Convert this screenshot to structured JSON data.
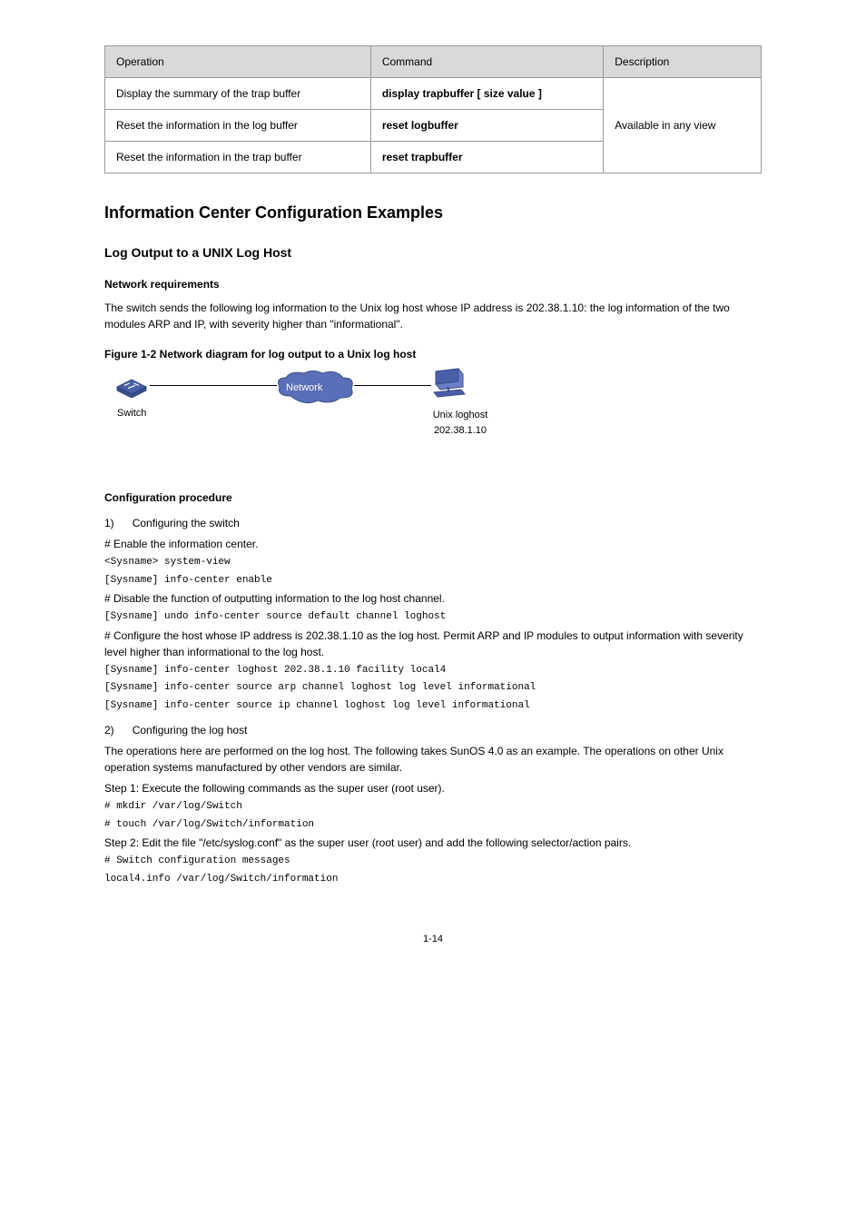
{
  "table": {
    "headers": [
      "Operation",
      "Command",
      "Description"
    ],
    "rows": [
      {
        "op": "Display the summary of the trap buffer",
        "cmd": "display trapbuffer [ size value ]",
        "desc_rowspan": true
      },
      {
        "op": "Reset the information in the log buffer",
        "cmd": "reset logbuffer",
        "desc": ""
      },
      {
        "op": "Reset the information in the trap buffer",
        "cmd": "reset trapbuffer",
        "desc": "Available in any view"
      }
    ]
  },
  "h1": "Information Center Configuration Examples",
  "h2_1": "Log Output to a UNIX Log Host",
  "h3_1": "Network requirements",
  "req_p1": "The switch sends the following log information to the Unix log host whose IP address is 202.38.1.10: the log information of the two modules ARP and IP, with severity higher than \"informational\".",
  "fig_caption": "Figure 1-2 Network diagram for log output to a Unix log host",
  "diagram": {
    "switch_label": "Switch",
    "cloud_label": "Network",
    "host_label_line1": "Unix loghost",
    "host_label_line2": "202.38.1.10"
  },
  "h3_2": "Configuration procedure",
  "step1_label": "1)",
  "step1_text": "Configuring the switch",
  "desc1": "# Enable the information center.",
  "cmd1a": "<Sysname> system-view",
  "cmd1b": "[Sysname] info-center enable",
  "desc2": "# Disable the function of outputting information to the log host channel.",
  "cmd2": "[Sysname] undo info-center source default channel loghost",
  "desc3": "# Configure the host whose IP address is 202.38.1.10 as the log host. Permit ARP and IP modules to output information with severity level higher than informational to the log host.",
  "cmd3a": "[Sysname] info-center loghost 202.38.1.10 facility local4",
  "cmd3b": "[Sysname] info-center source arp channel loghost log level informational",
  "cmd3c": "[Sysname] info-center source ip channel loghost log level informational",
  "step2_label": "2)",
  "step2_text": "Configuring the log host",
  "p_step2": "The operations here are performed on the log host. The following takes SunOS 4.0 as an example. The operations on other Unix operation systems manufactured by other vendors are similar.",
  "stepA_label": "Step 1:",
  "stepA_text": "Execute the following commands as the super user (root user).",
  "cmdA1": "# mkdir /var/log/Switch",
  "cmdA2": "# touch /var/log/Switch/information",
  "stepB_label": "Step 2:",
  "stepB_text": "Edit the file \"/etc/syslog.conf\" as the super user (root user) and add the following selector/action pairs.",
  "cmdB1": "# Switch configuration messages",
  "cmdB2": "local4.info /var/log/Switch/information",
  "page_number": "1-14"
}
